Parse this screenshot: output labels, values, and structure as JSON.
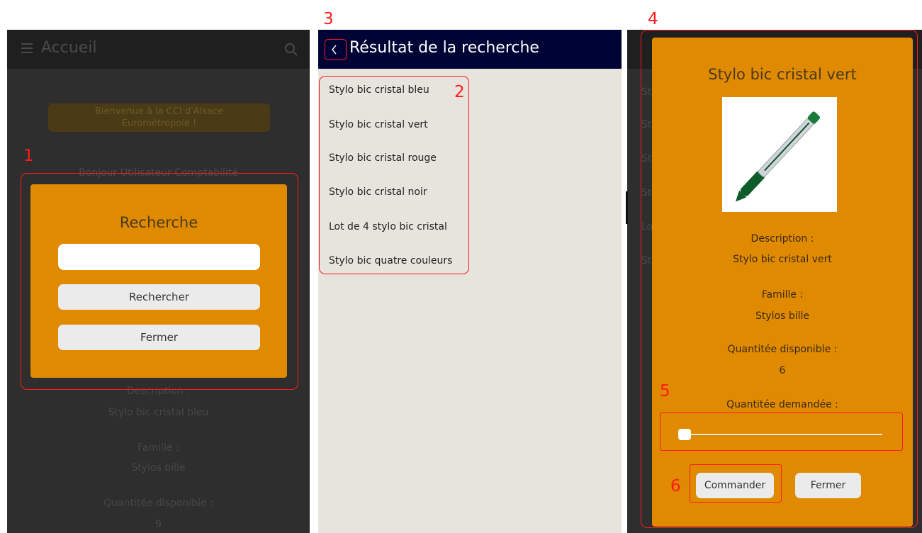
{
  "panel1": {
    "title": "Accueil",
    "welcome": "Bienvenue à la CCI d'Alsace Eurométropole !",
    "greeting": "Bonjour Utilisateur Comptabilité",
    "bg_description_label": "Description :",
    "bg_description_value": "Stylo bic cristal bleu",
    "bg_famille_label": "Famille :",
    "bg_famille_value": "Stylos bille",
    "bg_qty_label": "Quantitée disponible :",
    "bg_qty_value": "9",
    "dialog": {
      "title": "Recherche",
      "input_value": "",
      "search_button": "Rechercher",
      "close_button": "Fermer"
    }
  },
  "panel2": {
    "title": "Résultat de la recherche",
    "items": [
      "Stylo bic cristal bleu",
      "Stylo bic cristal vert",
      "Stylo bic cristal rouge",
      "Stylo bic cristal noir",
      "Lot de 4 stylo bic cristal",
      "Stylo bic quatre couleurs"
    ]
  },
  "panel3": {
    "bg_item_prefixes": [
      "St",
      "St",
      "St",
      "St",
      "Lo",
      "St"
    ],
    "dialog": {
      "title": "Stylo bic cristal vert",
      "description_label": "Description :",
      "description_value": "Stylo bic cristal vert",
      "famille_label": "Famille :",
      "famille_value": "Stylos bille",
      "qty_available_label": "Quantitée disponible :",
      "qty_available_value": "6",
      "qty_requested_label": "Quantitée demandée :",
      "slider_value": 0,
      "order_button": "Commander",
      "close_button": "Fermer"
    }
  },
  "annotations": [
    "1",
    "2",
    "3",
    "4",
    "5",
    "6"
  ],
  "colors": {
    "dialog_orange": "#df8a00",
    "header_navy": "#000435",
    "overlay_dark": "#2e2e2e",
    "list_bg": "#e7e3dd",
    "annotation_red": "#ff1a1a"
  }
}
